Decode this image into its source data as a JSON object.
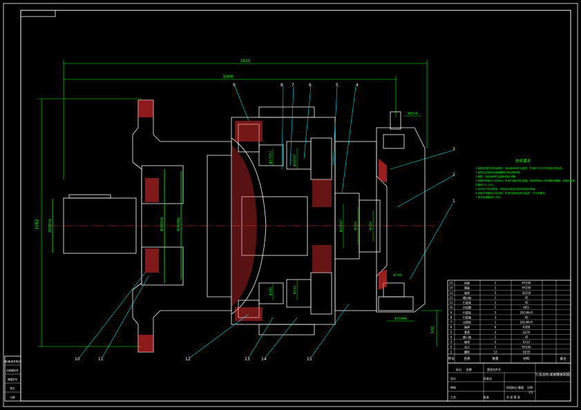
{
  "sheet": {
    "corner_box": "",
    "dim_overall": "1620",
    "dim_inner": "1300",
    "dim_height": "1062",
    "dim_right": "500",
    "dim_left_shaft": "Φ200h6",
    "dim_bearing_left": "Φ300h6",
    "dim_bearing_left2": "Φ260K6",
    "dim_mid1": "Φ170H7",
    "dim_mid2": "Φ160H7",
    "dim_mid3": "Φ150",
    "dim_mid4": "Φ140",
    "dim_right1": "Φ200H7",
    "dim_right2": "Φ110",
    "dim_right3": "Φ130",
    "dim_right4": "Φ100",
    "dim_bottom_right": "Φ110K6",
    "dim_top_key": "Φ45h6"
  },
  "notes": {
    "title": "技术要求",
    "lines": [
      "1.装配前零件用煤油清洗，滚动轴承用汽油清洗，机体内不允许有任何杂物存在。",
      "2.装配后应检查齿面接触斑点和齿侧间隙。",
      "3.调整、固定轴承时应留有轴向间隙。",
      "4.润滑剂采用N32机械油，机体内装至规定高度；轴承采用ZL-3号锂基润滑脂，用量为轴承",
      "  空隙的1/3~1/2。",
      "5.密封处不允许漏油，机体接合面应涂密封胶或水玻璃。",
      "6.机座外表面涂灰色油漆，机体内表面涂耐油油漆，不允许漏涂。",
      "7.按试验规程进行试验。"
    ]
  },
  "callouts": [
    "1",
    "2",
    "3",
    "4",
    "5",
    "6",
    "7",
    "8",
    "9",
    "10",
    "11",
    "12",
    "13",
    "14",
    "15"
  ],
  "bom": {
    "headers": [
      "序号",
      "名称",
      "数量",
      "材料",
      "备注"
    ],
    "rows": [
      [
        "15",
        "机座",
        "1",
        "HT200",
        ""
      ],
      [
        "14",
        "端盖",
        "1",
        "HT200",
        ""
      ],
      [
        "13",
        "轴承",
        "2",
        "30218",
        ""
      ],
      [
        "12",
        "输出轴",
        "1",
        "45",
        ""
      ],
      [
        "11",
        "行星架",
        "1",
        "45",
        ""
      ],
      [
        "10",
        "内齿圈",
        "1",
        "40Cr",
        ""
      ],
      [
        "9",
        "行星轮",
        "3",
        "20CrMnTi",
        ""
      ],
      [
        "8",
        "行星轴",
        "3",
        "45",
        ""
      ],
      [
        "7",
        "太阳轮",
        "1",
        "20CrMnTi",
        ""
      ],
      [
        "6",
        "轴承",
        "6",
        "6308",
        ""
      ],
      [
        "5",
        "套筒",
        "3",
        "Q235",
        ""
      ],
      [
        "4",
        "输入轴",
        "1",
        "45",
        ""
      ],
      [
        "3",
        "轴承",
        "2",
        "6212",
        ""
      ],
      [
        "2",
        "法兰",
        "1",
        "HT200",
        ""
      ],
      [
        "1",
        "螺栓",
        "12",
        "Q235",
        ""
      ]
    ]
  },
  "title_block": {
    "drawing_name": "行星齿轮减速器装配图",
    "labels": [
      "标记",
      "处数",
      "分区",
      "更改文件号",
      "签名",
      "年月日",
      "设计",
      "标准化",
      "审核",
      "工艺",
      "批准"
    ],
    "stage": "阶段标记",
    "weight": "重量",
    "scale": "比例",
    "scale_value": "1:5",
    "sheet_info": "共 张  第 张"
  },
  "side_block": {
    "labels": [
      "借(通)用件登记",
      "旧底图总号",
      "底图总号",
      "签字",
      "日期"
    ]
  },
  "colors": {
    "background": "#000000",
    "outline": "#ffffff",
    "dimension": "#00ff00",
    "hatch": "#ff3333",
    "leader": "#00e5e5",
    "centerline": "#ff4040"
  }
}
